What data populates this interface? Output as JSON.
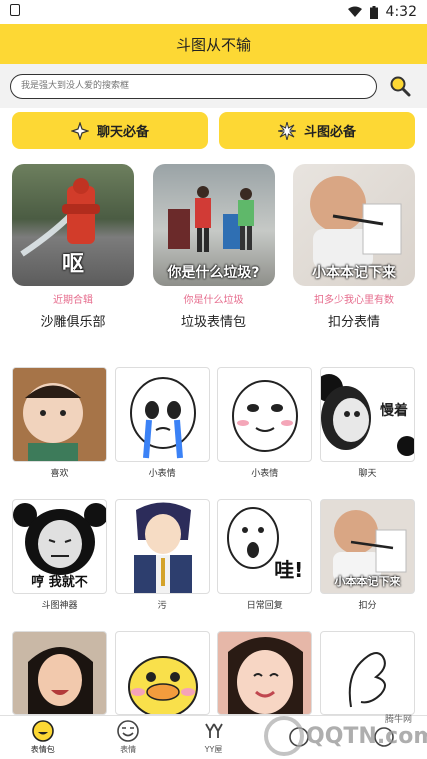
{
  "status_bar": {
    "time": "4:32"
  },
  "header": {
    "title": "斗图从不输"
  },
  "search": {
    "placeholder": "我是强大到没人爱的搜索框"
  },
  "categories": [
    {
      "label": "聊天必备",
      "icon": "sparkle-icon"
    },
    {
      "label": "斗图必备",
      "icon": "burst-icon"
    }
  ],
  "featured": [
    {
      "subtitle": "近期合辑",
      "title": "沙雕俱乐部",
      "caption": "呕"
    },
    {
      "subtitle": "你是什么垃圾",
      "title": "垃圾表情包",
      "caption": "你是什么垃圾?"
    },
    {
      "subtitle": "扣多少我心里有数",
      "title": "扣分表情",
      "caption": "小本本记下来"
    }
  ],
  "grid_rows": [
    [
      {
        "label": "喜欢",
        "caption": ""
      },
      {
        "label": "小表情",
        "caption": ""
      },
      {
        "label": "小表情",
        "caption": ""
      },
      {
        "label": "聊天",
        "caption": "慢着"
      }
    ],
    [
      {
        "label": "斗图神器",
        "caption": "哼 我就不"
      },
      {
        "label": "污",
        "caption": ""
      },
      {
        "label": "日常回复",
        "caption": "哇!"
      },
      {
        "label": "扣分",
        "caption": "小本本记下来"
      }
    ],
    [
      {
        "label": "",
        "caption": ""
      },
      {
        "label": "",
        "caption": ""
      },
      {
        "label": "",
        "caption": ""
      },
      {
        "label": "",
        "caption": ""
      }
    ]
  ],
  "bottom_nav": [
    {
      "label": "表情包",
      "icon": "smiley-face-icon",
      "active": true
    },
    {
      "label": "表情",
      "icon": "emoji-face-icon",
      "active": false
    },
    {
      "label": "YY屋",
      "icon": "yy-house-icon",
      "active": false
    },
    {
      "label": "",
      "icon": "extra-icon",
      "active": false
    },
    {
      "label": "",
      "icon": "extra-icon",
      "active": false
    }
  ],
  "watermark": {
    "text": "QQTN.com",
    "small_text": "腾牛网"
  },
  "colors": {
    "accent": "#fdd834",
    "pink": "#e66b8c"
  }
}
